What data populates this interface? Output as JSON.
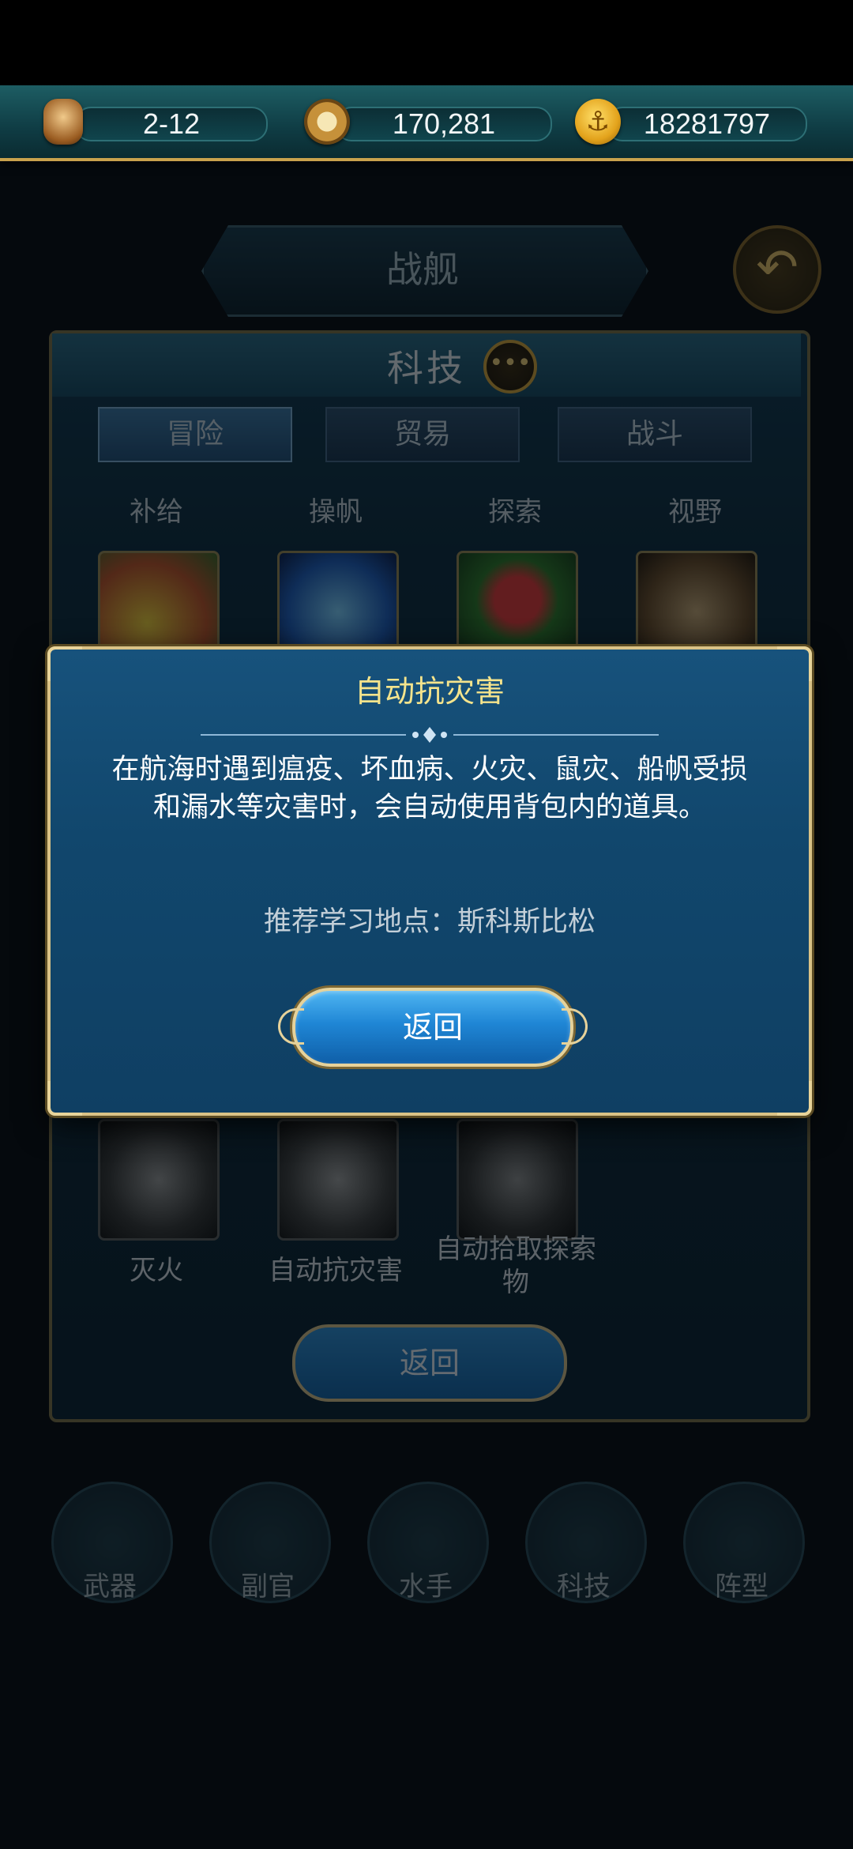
{
  "resources": {
    "date": "2-12",
    "silver": "170,281",
    "gold": "18281797"
  },
  "background": {
    "ship_title": "战舰",
    "panel_title": "科技",
    "tabs": [
      "冒险",
      "贸易",
      "战斗"
    ],
    "categories": [
      "补给",
      "操帆",
      "探索",
      "视野"
    ],
    "row3_labels": [
      "灭火",
      "自动抗灾害",
      "自动拾取探索物"
    ],
    "return_label": "返回",
    "nav": [
      "武器",
      "副官",
      "水手",
      "科技",
      "阵型"
    ]
  },
  "modal": {
    "title": "自动抗灾害",
    "description": "在航海时遇到瘟疫、坏血病、火灾、鼠灾、船帆受损和漏水等灾害时，会自动使用背包内的道具。",
    "location_label": "推荐学习地点：",
    "location": "斯科斯比松",
    "button_label": "返回"
  }
}
